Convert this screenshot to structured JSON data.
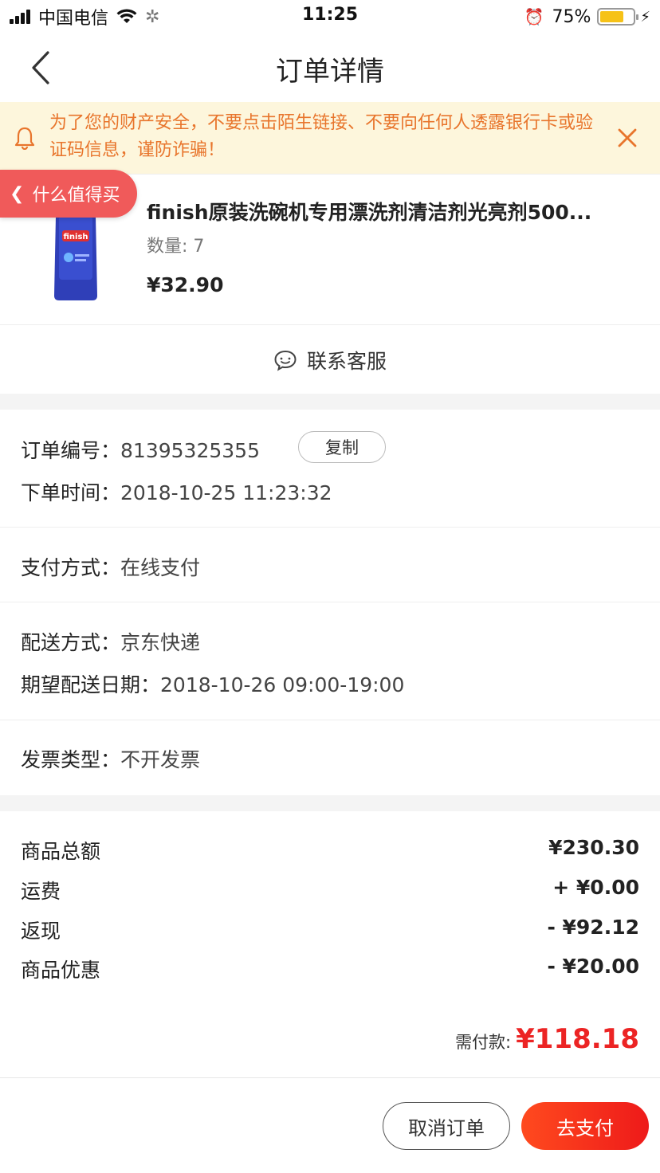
{
  "status_bar": {
    "carrier": "中国电信",
    "time": "11:25",
    "battery_percent": "75%",
    "battery_level": 0.75,
    "battery_color": "#f6c218"
  },
  "nav": {
    "title": "订单详情",
    "back_icon": "chevron-left-icon"
  },
  "warning": {
    "text": "为了您的财产安全，不要点击陌生链接、不要向任何人透露银行卡或验证码信息，谨防诈骗！",
    "icon": "bell-icon",
    "close_icon": "close-icon",
    "color": "#e8752c",
    "background": "#fdf6dc"
  },
  "return_pill": {
    "label": "什么值得买",
    "color": "#f05a5a"
  },
  "product": {
    "name": "finish原装洗碗机专用漂洗剂清洁剂光亮剂500...",
    "quantity": "数量: 7",
    "price": "¥32.90",
    "image_brand": "finish"
  },
  "service": {
    "label": "联系客服",
    "icon": "chat-bubble-icon"
  },
  "order_info": {
    "order_no_label": "订单编号：",
    "order_no": "81395325355",
    "copy_label": "复制",
    "order_time_label": "下单时间：",
    "order_time": "2018-10-25 11:23:32",
    "payment_label": "支付方式：",
    "payment": "在线支付",
    "delivery_label": "配送方式：",
    "delivery": "京东快递",
    "expected_label": "期望配送日期：",
    "expected": "2018-10-26 09:00-19:00",
    "invoice_label": "发票类型：",
    "invoice": "不开发票"
  },
  "summary": {
    "items": [
      {
        "label": "商品总额",
        "amount": "¥230.30"
      },
      {
        "label": "运费",
        "amount": "+ ¥0.00"
      },
      {
        "label": "返现",
        "amount": "- ¥92.12"
      },
      {
        "label": "商品优惠",
        "amount": "- ¥20.00"
      }
    ],
    "due_label": "需付款:",
    "due_amount": "¥118.18",
    "due_color": "#ec2424"
  },
  "footer": {
    "cancel_label": "取消订单",
    "pay_label": "去支付",
    "pay_color": "#ff3a1e"
  }
}
